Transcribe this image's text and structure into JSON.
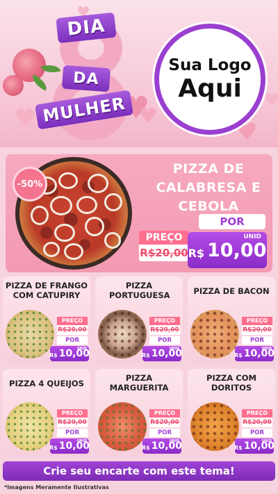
{
  "header": {
    "ribbon_line1": "DIA",
    "ribbon_line2": "DA",
    "ribbon_line3": "MULHER",
    "big_number": "8",
    "logo_line1": "Sua Logo",
    "logo_line2": "Aqui"
  },
  "featured": {
    "discount": "-50%",
    "title": "PIZZA DE CALABRESA E CEBOLA",
    "preco_label": "PREÇO",
    "old_price": "R$20,00",
    "por_label": "POR",
    "currency": "R$",
    "new_price": "10,00",
    "unit": "UNID"
  },
  "price_labels": {
    "preco": "PREÇO",
    "por": "POR",
    "currency": "R$",
    "unit": "UNID"
  },
  "products": [
    {
      "name": "PIZZA DE FRANGO COM CATUPIRY",
      "old_price": "R$20,00",
      "new_price": "10,00"
    },
    {
      "name": "PIZZA PORTUGUESA",
      "old_price": "R$20,00",
      "new_price": "10,00"
    },
    {
      "name": "PIZZA DE BACON",
      "old_price": "R$20,00",
      "new_price": "10,00"
    },
    {
      "name": "PIZZA 4 QUEIJOS",
      "old_price": "R$20,00",
      "new_price": "10,00"
    },
    {
      "name": "PIZZA MARGUERITA",
      "old_price": "R$20,00",
      "new_price": "10,00"
    },
    {
      "name": "PIZZA COM DORITOS",
      "old_price": "R$20,00",
      "new_price": "10,00"
    }
  ],
  "footer": {
    "cta": "Crie seu encarte com este tema!",
    "disclaimer": "*Imagens Meramente Ilustrativas"
  },
  "colors": {
    "purple": "#8a2bc8",
    "pink": "#f39ab3",
    "sale_red": "#ee4f6e"
  }
}
